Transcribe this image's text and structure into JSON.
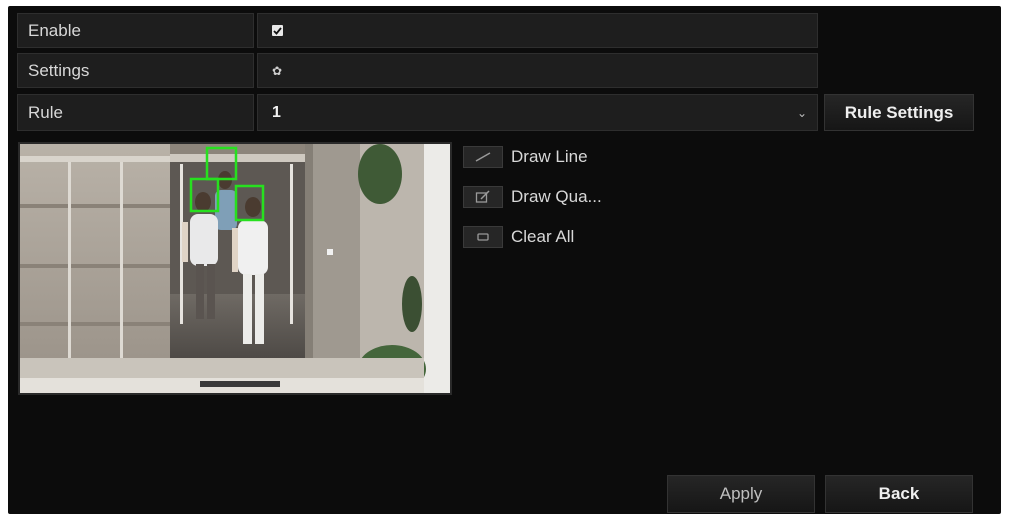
{
  "enable": {
    "label": "Enable",
    "checked": true
  },
  "settings": {
    "label": "Settings",
    "icon": "gear-icon"
  },
  "rule": {
    "label": "Rule",
    "value": "1",
    "settings_button": "Rule Settings"
  },
  "tools": [
    {
      "label": "Draw Line",
      "icon": "draw-line-icon"
    },
    {
      "label": "Draw Qua...",
      "icon": "draw-quadrilateral-icon"
    },
    {
      "label": "Clear All",
      "icon": "eraser-icon"
    }
  ],
  "detection_boxes": 3,
  "colors": {
    "detection_box": "#27e01f",
    "panel_bg": "#0c0c0c",
    "field_bg": "#1e1e1e"
  },
  "footer": {
    "apply": "Apply",
    "back": "Back"
  }
}
